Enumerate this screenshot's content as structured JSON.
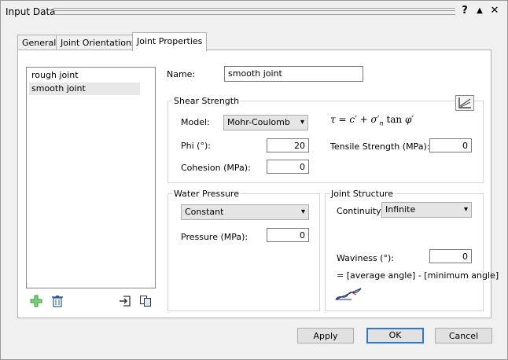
{
  "window": {
    "title": "Input Data"
  },
  "titlebar_buttons": {
    "help": "?",
    "up": "▲",
    "close": "✕"
  },
  "tabs": [
    {
      "label": "General"
    },
    {
      "label": "Joint Orientations"
    },
    {
      "label": "Joint Properties",
      "active": true
    }
  ],
  "joints": {
    "items": [
      "rough joint",
      "smooth joint"
    ],
    "selected": "smooth joint"
  },
  "name": {
    "label": "Name:",
    "value": "smooth joint"
  },
  "shear": {
    "title": "Shear Strength",
    "model_label": "Model:",
    "model_value": "Mohr-Coulomb",
    "phi_label": "Phi (°):",
    "phi_value": "20",
    "cohesion_label": "Cohesion (MPa):",
    "cohesion_value": "0",
    "tensile_label": "Tensile Strength (MPa):",
    "tensile_value": "0",
    "formula": {
      "tau": "τ",
      "eq": "=",
      "c": "c′",
      "plus": "+",
      "sigma": "σ′",
      "sub": "n",
      "tan": "tan",
      "phi": "φ′"
    }
  },
  "water": {
    "title": "Water Pressure",
    "type_value": "Constant",
    "pressure_label": "Pressure (MPa):",
    "pressure_value": "0"
  },
  "structure": {
    "title": "Joint Structure",
    "continuity_label": "Continuity:",
    "continuity_value": "Infinite",
    "waviness_label": "Waviness (°):",
    "waviness_value": "0",
    "note": "= [average angle] - [minimum angle]"
  },
  "buttons": {
    "apply": "Apply",
    "ok": "OK",
    "cancel": "Cancel"
  },
  "colors": {
    "add": "#3a9b3a",
    "delete": "#2a5d9f",
    "default_border": "#2b79d1"
  }
}
